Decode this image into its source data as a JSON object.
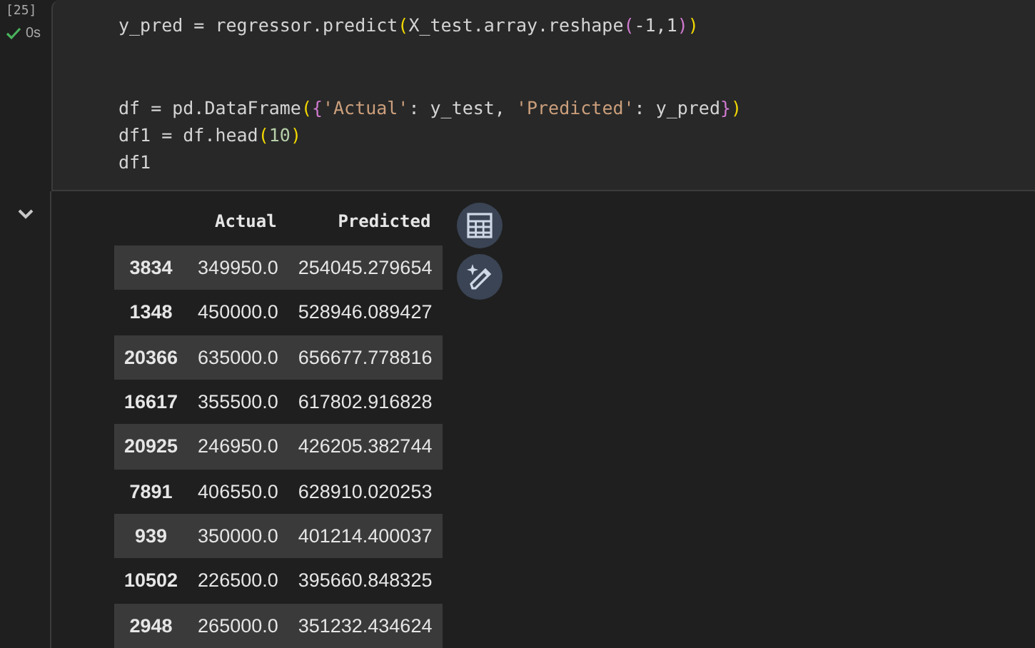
{
  "cell": {
    "execution_count": "[25]",
    "status": "0s",
    "code_blocks": [
      [
        [
          {
            "kind": "plain",
            "text": "y_pred = regressor.predict"
          },
          {
            "kind": "bracket1",
            "text": "("
          },
          {
            "kind": "plain",
            "text": "X_test.array.reshape"
          },
          {
            "kind": "bracket2",
            "text": "("
          },
          {
            "kind": "plain",
            "text": "-1,1"
          },
          {
            "kind": "bracket2",
            "text": ")"
          },
          {
            "kind": "bracket1",
            "text": ")"
          }
        ]
      ],
      [
        [
          {
            "kind": "plain",
            "text": "df = pd.DataFrame"
          },
          {
            "kind": "bracket1",
            "text": "("
          },
          {
            "kind": "bracket2",
            "text": "{"
          },
          {
            "kind": "string",
            "text": "'Actual'"
          },
          {
            "kind": "plain",
            "text": ": y_test, "
          },
          {
            "kind": "string",
            "text": "'Predicted'"
          },
          {
            "kind": "plain",
            "text": ": y_pred"
          },
          {
            "kind": "bracket2",
            "text": "}"
          },
          {
            "kind": "bracket1",
            "text": ")"
          }
        ],
        [
          {
            "kind": "plain",
            "text": "df1 = df.head"
          },
          {
            "kind": "bracket1",
            "text": "("
          },
          {
            "kind": "number",
            "text": "10"
          },
          {
            "kind": "bracket1",
            "text": ")"
          }
        ],
        [
          {
            "kind": "plain",
            "text": "df1"
          }
        ]
      ]
    ]
  },
  "output": {
    "table": {
      "columns": [
        "Actual",
        "Predicted"
      ],
      "rows": [
        {
          "index": "3834",
          "cells": [
            "349950.0",
            "254045.279654"
          ]
        },
        {
          "index": "1348",
          "cells": [
            "450000.0",
            "528946.089427"
          ]
        },
        {
          "index": "20366",
          "cells": [
            "635000.0",
            "656677.778816"
          ]
        },
        {
          "index": "16617",
          "cells": [
            "355500.0",
            "617802.916828"
          ]
        },
        {
          "index": "20925",
          "cells": [
            "246950.0",
            "426205.382744"
          ]
        },
        {
          "index": "7891",
          "cells": [
            "406550.0",
            "628910.020253"
          ]
        },
        {
          "index": "939",
          "cells": [
            "350000.0",
            "401214.400037"
          ]
        },
        {
          "index": "10502",
          "cells": [
            "226500.0",
            "395660.848325"
          ]
        },
        {
          "index": "2948",
          "cells": [
            "265000.0",
            "351232.434624"
          ]
        }
      ]
    }
  }
}
